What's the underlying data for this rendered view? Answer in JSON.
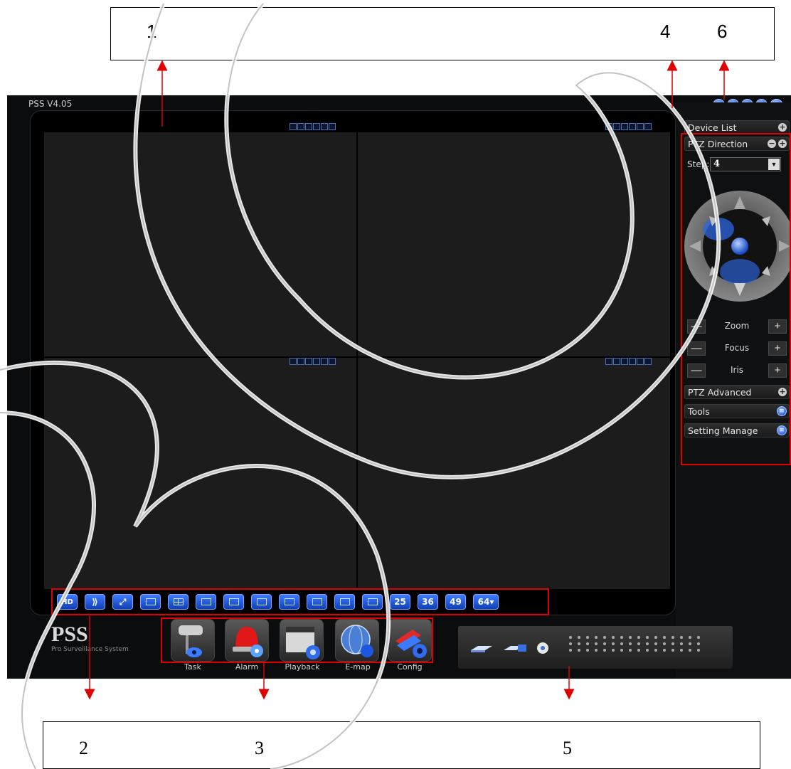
{
  "callouts": {
    "top_numbers": [
      "1",
      "4",
      "6"
    ],
    "bottom_numbers": [
      "2",
      "3",
      "5"
    ]
  },
  "window": {
    "title": "PSS  V4.05",
    "controls": [
      "lock-icon",
      "info-icon",
      "minimize-icon",
      "restore-icon",
      "close-icon"
    ]
  },
  "layout_bar": {
    "buttons": [
      "HD",
      "",
      "",
      "",
      "",
      "",
      "",
      "",
      "",
      "",
      "",
      "",
      "25",
      "36",
      "49",
      "64▾"
    ]
  },
  "right_panel": {
    "device_list": "Device List",
    "ptz_direction": "PTZ Direction",
    "step_label": "Step:",
    "step_value": "4",
    "zoom": "Zoom",
    "focus": "Focus",
    "iris": "Iris",
    "minus": "—",
    "plus": "+",
    "ptz_advanced": "PTZ Advanced",
    "tools": "Tools",
    "setting_manage": "Setting Manage"
  },
  "logo": {
    "name": "PSS",
    "tagline": "Pro Surveillance System"
  },
  "taskbar": {
    "task": "Task",
    "alarm": "Alarm",
    "playback": "Playback",
    "emap": "E-map",
    "config": "Config"
  },
  "colors": {
    "callout_arrow": "#e00000",
    "accent_blue": "#2b63e6"
  }
}
